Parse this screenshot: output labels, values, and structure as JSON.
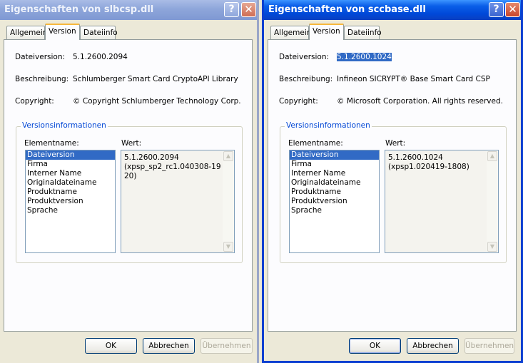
{
  "left": {
    "title": "Eigenschaften von slbcsp.dll",
    "tabs": [
      "Allgemein",
      "Version",
      "Dateiinfo"
    ],
    "labels": {
      "version": "Dateiversion:",
      "desc": "Beschreibung:",
      "copyright": "Copyright:",
      "group": "Versionsinformationen",
      "element": "Elementname:",
      "value": "Wert:"
    },
    "version": "5.1.2600.2094",
    "description": "Schlumberger Smart Card CryptoAPI Library",
    "copyright": "© Copyright Schlumberger Technology Corp.",
    "items": [
      "Dateiversion",
      "Firma",
      "Interner Name",
      "Originaldateiname",
      "Produktname",
      "Produktversion",
      "Sprache"
    ],
    "value_text": "5.1.2600.2094\n(xpsp_sp2_rc1.040308-19\n20)",
    "buttons": {
      "ok": "OK",
      "cancel": "Abbrechen",
      "apply": "Übernehmen"
    }
  },
  "right": {
    "title": "Eigenschaften von sccbase.dll",
    "tabs": [
      "Allgemein",
      "Version",
      "Dateiinfo"
    ],
    "labels": {
      "version": "Dateiversion:",
      "desc": "Beschreibung:",
      "copyright": "Copyright:",
      "group": "Versionsinformationen",
      "element": "Elementname:",
      "value": "Wert:"
    },
    "version": "5.1.2600.1024",
    "description": "Infineon SICRYPT® Base Smart Card CSP",
    "copyright": "© Microsoft Corporation. All rights reserved.",
    "items": [
      "Dateiversion",
      "Firma",
      "Interner Name",
      "Originaldateiname",
      "Produktname",
      "Produktversion",
      "Sprache"
    ],
    "value_text": "5.1.2600.1024\n(xpsp1.020419-1808)",
    "buttons": {
      "ok": "OK",
      "cancel": "Abbrechen",
      "apply": "Übernehmen"
    }
  },
  "icons": {
    "help": "help-icon",
    "close": "close-icon",
    "scroll_up": "scroll-up-arrow-icon",
    "scroll_down": "scroll-down-arrow-icon"
  },
  "colors": {
    "active_title": "#0054e3",
    "inactive_title": "#8ea6da",
    "selection": "#316ac5",
    "group_legend": "#0046d5"
  }
}
